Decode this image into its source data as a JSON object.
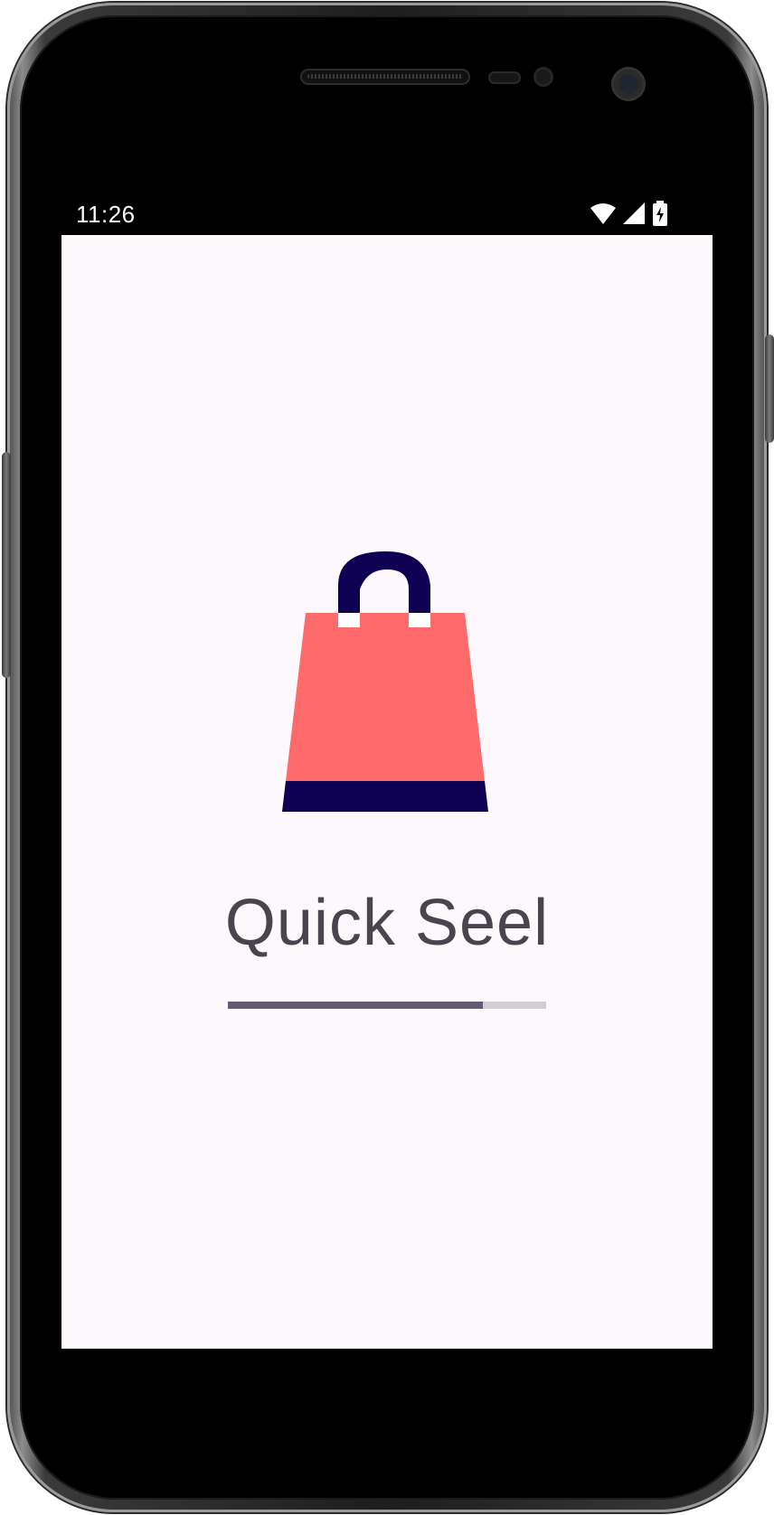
{
  "status_bar": {
    "time": "11:26",
    "icons": [
      "wifi-icon",
      "cellular-signal-icon",
      "battery-charging-icon"
    ]
  },
  "app": {
    "title": "Quick Seel",
    "logo": "shopping-bag-icon",
    "loading_progress": 0.8
  },
  "colors": {
    "background": "#fdf8fc",
    "bag_body": "#ff6b6b",
    "bag_accent": "#0e0052",
    "title_text": "#49454f",
    "progress_fill": "#625b71",
    "progress_track": "#d2ccd3"
  }
}
